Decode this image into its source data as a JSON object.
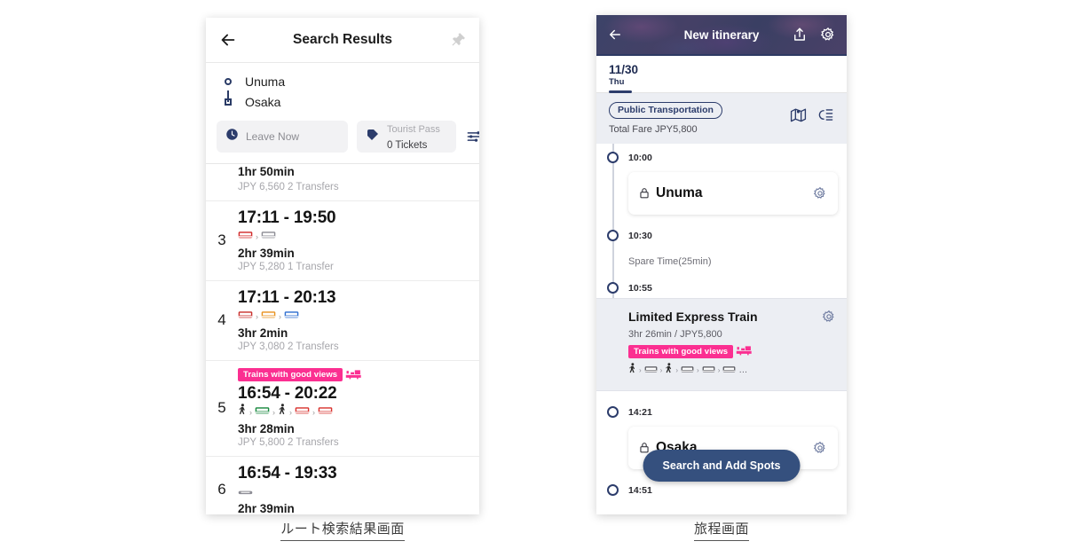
{
  "left_panel": {
    "header": {
      "title": "Search Results",
      "back_icon": "arrow-left-icon",
      "pin_icon": "pushpin-icon"
    },
    "route": {
      "origin": "Unuma",
      "destination": "Osaka"
    },
    "controls": {
      "leave_label": "Leave Now",
      "pass_title": "Tourist Pass",
      "pass_value": "0 Tickets",
      "filter_icon": "filter-sliders-icon"
    },
    "results": [
      {
        "index": "",
        "times": "",
        "duration": "1hr 50min",
        "fare": "JPY 6,560 2 Transfers",
        "tag": "",
        "modes": []
      },
      {
        "index": "3",
        "times": "17:11 - 19:50",
        "duration": "2hr 39min",
        "fare": "JPY 5,280 1 Transfer",
        "tag": "",
        "modes": [
          "train-red",
          "train-gray"
        ]
      },
      {
        "index": "4",
        "times": "17:11 - 20:13",
        "duration": "3hr 2min",
        "fare": "JPY 3,080 2 Transfers",
        "tag": "",
        "modes": [
          "train-red",
          "train-orange",
          "train-blue"
        ]
      },
      {
        "index": "5",
        "times": "16:54 - 20:22",
        "duration": "3hr 28min",
        "fare": "JPY 5,800 2 Transfers",
        "tag": "Trains with good views",
        "modes": [
          "walk",
          "train-green",
          "walk",
          "train-red",
          "train-red"
        ]
      },
      {
        "index": "6",
        "times": "16:54 - 19:33",
        "duration": "2hr 39min",
        "fare": "",
        "tag": "",
        "modes": [
          "train-gray"
        ]
      }
    ],
    "caption": "ルート検索結果画面"
  },
  "right_panel": {
    "header": {
      "title": "New itinerary",
      "back_icon": "arrow-left-icon",
      "share_icon": "share-icon",
      "settings_icon": "gear-icon"
    },
    "date_tab": {
      "date": "11/30",
      "weekday": "Thu"
    },
    "summary": {
      "chip": "Public Transportation",
      "total_fare": "Total Fare JPY5,800",
      "map_icon": "map-icon",
      "route_list_icon": "route-list-icon"
    },
    "timeline": [
      {
        "type": "time",
        "time": "10:00"
      },
      {
        "type": "place",
        "name": "Unuma",
        "lock_icon": "lock-icon",
        "gear_icon": "gear-icon"
      },
      {
        "type": "time",
        "time": "10:30"
      },
      {
        "type": "note",
        "text": "Spare Time(25min)"
      },
      {
        "type": "time",
        "time": "10:55"
      },
      {
        "type": "segment",
        "title": "Limited Express Train",
        "meta": "3hr 26min / JPY5,800",
        "tag": "Trains with good views",
        "modes": [
          "walk",
          "train-gray",
          "walk",
          "train-gray",
          "train-gray",
          "train-gray"
        ],
        "modes_overflow": "…",
        "gear_icon": "gear-icon"
      },
      {
        "type": "time",
        "time": "14:21"
      },
      {
        "type": "place",
        "name": "Osaka",
        "lock_icon": "lock-icon",
        "gear_icon": "gear-icon"
      },
      {
        "type": "time",
        "time": "14:51"
      }
    ],
    "fab_label": "Search and Add Spots",
    "caption": "旅程画面"
  },
  "colors": {
    "navy": "#2c3c6b",
    "pink": "#fb2f91",
    "fab": "#35507e",
    "band": "#eceef3"
  }
}
